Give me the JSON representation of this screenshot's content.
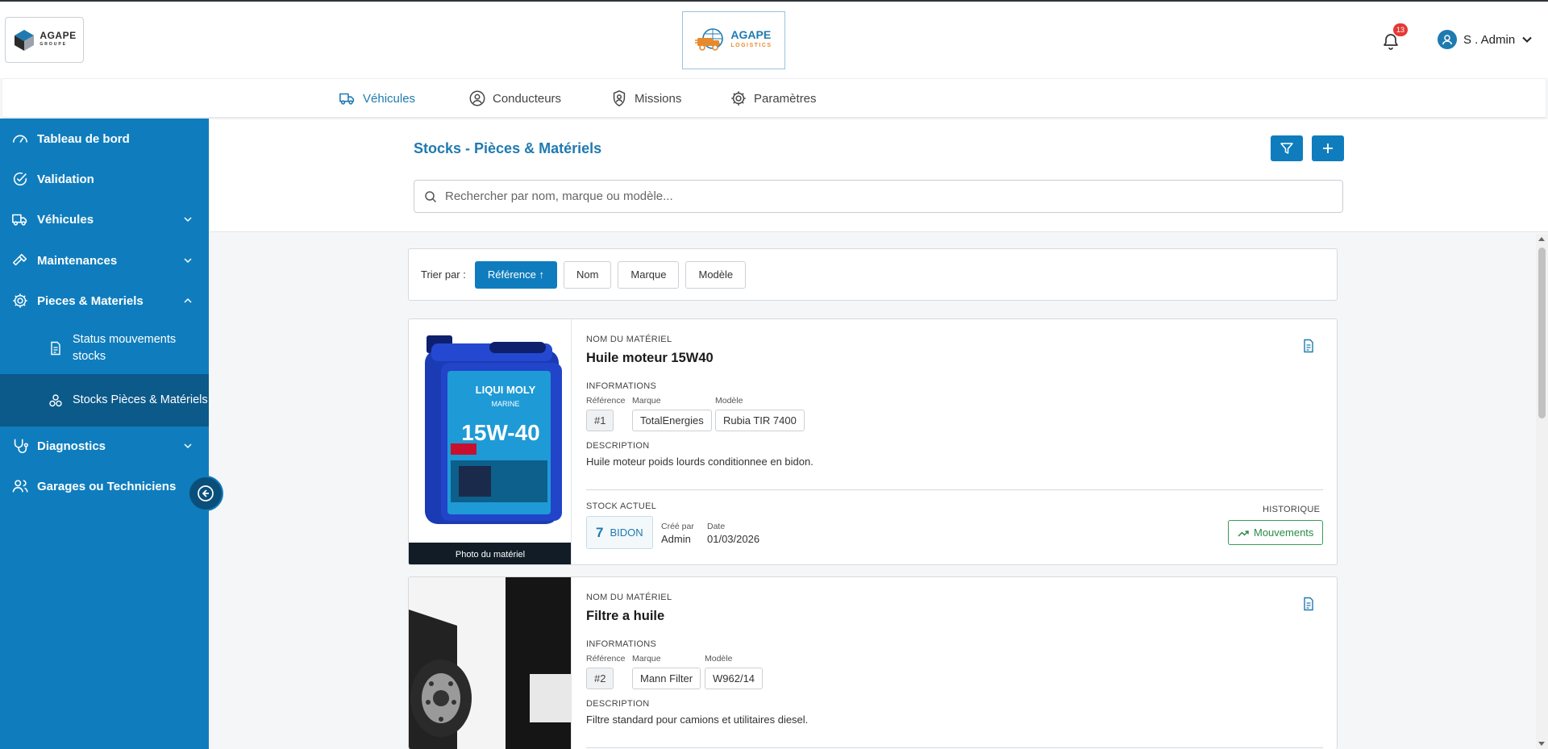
{
  "brand": {
    "left_name": "AGAPE",
    "left_sub": "GROUPE",
    "center_name": "AGAPE",
    "center_sub": "LOGISTICS"
  },
  "header": {
    "notifications_count": "13",
    "user_name": "S . Admin"
  },
  "nav": [
    {
      "label": "Véhicules",
      "icon": "truck-icon",
      "active": true
    },
    {
      "label": "Conducteurs",
      "icon": "user-circle-icon"
    },
    {
      "label": "Missions",
      "icon": "user-badge-icon"
    },
    {
      "label": "Paramètres",
      "icon": "gear-icon"
    }
  ],
  "sidebar": {
    "items": [
      {
        "label": "Tableau de bord",
        "icon": "gauge-icon"
      },
      {
        "label": "Validation",
        "icon": "check-circle-icon"
      },
      {
        "label": "Véhicules",
        "icon": "truck-icon",
        "expandable": true
      },
      {
        "label": "Maintenances",
        "icon": "hammer-icon",
        "expandable": true
      },
      {
        "label": "Pieces & Materiels",
        "icon": "gear-icon",
        "expanded": true
      },
      {
        "label": "Diagnostics",
        "icon": "stethoscope-icon",
        "expandable": true
      },
      {
        "label": "Garages ou Techniciens",
        "icon": "users-icon"
      }
    ],
    "subitems": [
      {
        "label": "Status mouvements stocks",
        "icon": "document-icon"
      },
      {
        "label": "Stocks Pièces & Matériels",
        "icon": "cogs-icon",
        "active": true
      }
    ]
  },
  "page": {
    "title": "Stocks - Pièces & Matériels",
    "search_placeholder": "Rechercher par nom, marque ou modèle..."
  },
  "sort": {
    "label": "Trier par :",
    "options": [
      "Référence ↑",
      "Nom",
      "Marque",
      "Modèle"
    ],
    "active": "Référence ↑"
  },
  "labels": {
    "name": "NOM DU MATÉRIEL",
    "info": "INFORMATIONS",
    "ref": "Référence",
    "brand": "Marque",
    "model": "Modèle",
    "description": "DESCRIPTION",
    "stock": "STOCK ACTUEL",
    "created_by": "Créé par",
    "date": "Date",
    "history": "HISTORIQUE",
    "movements_btn": "Mouvements",
    "photo_caption": "Photo du matériel"
  },
  "items": [
    {
      "name": "Huile moteur 15W40",
      "reference": "#1",
      "brand": "TotalEnergies",
      "model": "Rubia TIR 7400",
      "description": "Huile moteur poids lourds conditionnee en bidon.",
      "stock_qty": "7",
      "stock_unit": "BIDON",
      "created_by": "Admin",
      "date": "01/03/2026",
      "photo_text": {
        "brand": "LIQUI MOLY",
        "sub": "MARINE",
        "grade": "15W-40"
      }
    },
    {
      "name": "Filtre a huile",
      "reference": "#2",
      "brand": "Mann Filter",
      "model": "W962/14",
      "description": "Filtre standard pour camions et utilitaires diesel."
    }
  ],
  "colors": {
    "primary": "#0f7dbd",
    "primary_dark": "#0b5a8a",
    "accent_green": "#2c8a48",
    "badge_red": "#e53935"
  }
}
